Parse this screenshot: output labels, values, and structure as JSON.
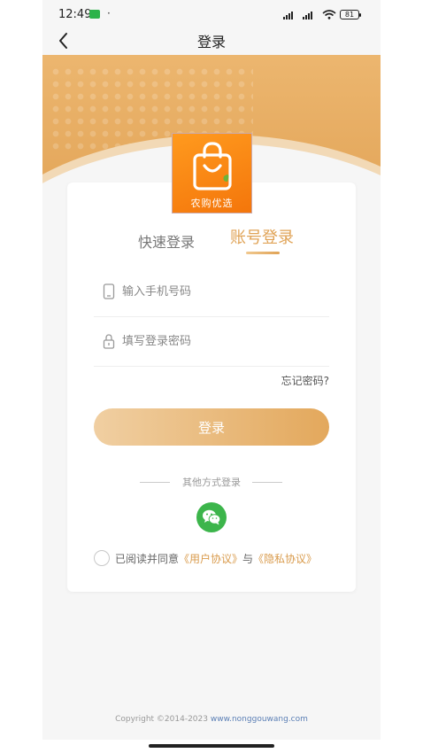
{
  "status_bar": {
    "time": "12:49",
    "dot": "·",
    "battery": "81"
  },
  "nav": {
    "title": "登录"
  },
  "logo": {
    "text": "农购优选"
  },
  "tabs": {
    "quick_login": "快速登录",
    "account_login": "账号登录",
    "active": "account_login"
  },
  "form": {
    "phone_placeholder": "输入手机号码",
    "password_placeholder": "填写登录密码",
    "forgot_label": "忘记密码?",
    "login_label": "登录"
  },
  "other": {
    "label": "其他方式登录",
    "wechat_icon": "wechat-icon"
  },
  "agreement": {
    "prefix": "已阅读并同意",
    "user_agreement": "《用户协议》",
    "connector": "与",
    "privacy_agreement": "《隐私协议》"
  },
  "footer": {
    "copyright": "Copyright ©2014-2023",
    "website": "www.nonggouwang.com"
  },
  "colors": {
    "accent": "#e0a356",
    "banner": "#e6ab62",
    "wechat": "#3cb54b",
    "logo": "#f7830f"
  }
}
